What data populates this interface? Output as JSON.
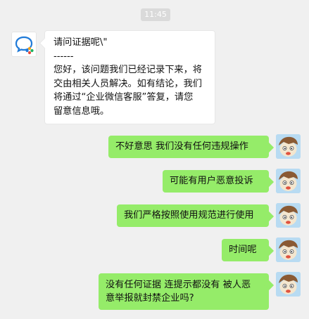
{
  "chat": {
    "timestamp": "11:45",
    "incoming": {
      "lines": [
        "请问证据呢\\\"",
        "------",
        "您好，该问题我们已经记录下来，将",
        "交由相关人员解决。如有结论，我们",
        "将通过“企业微信客服”答复，请您",
        "留意信息哦。"
      ]
    },
    "outgoing": [
      {
        "lines": [
          "不好意思  我们没有任何违规操作"
        ]
      },
      {
        "lines": [
          "可能有用户恶意投诉"
        ]
      },
      {
        "lines": [
          "我们严格按照使用规范进行使用"
        ]
      },
      {
        "lines": [
          "时间呢"
        ]
      },
      {
        "lines": [
          "没有任何证据 连提示都没有  被人恶",
          "意举报就封禁企业吗?"
        ]
      }
    ]
  },
  "colors": {
    "background": "#f0f0f0",
    "outgoing_bubble": "#95ec69",
    "incoming_bubble": "#ffffff",
    "timestamp_pill": "#dadada"
  },
  "icons": {
    "incoming_avatar": "wecom-logo-icon",
    "outgoing_avatar": "cartoon-face-avatar"
  }
}
